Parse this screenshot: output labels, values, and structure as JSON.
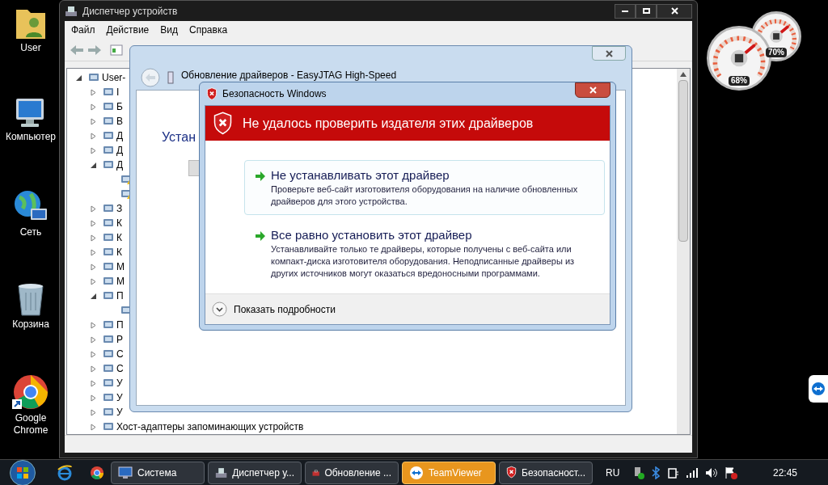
{
  "desktop": {
    "icons": [
      {
        "label": "User",
        "kind": "user"
      },
      {
        "label": "Компьютер",
        "kind": "computer"
      },
      {
        "label": "Сеть",
        "kind": "network"
      },
      {
        "label": "Корзина",
        "kind": "trash"
      },
      {
        "label": "Google Chrome",
        "kind": "chrome"
      }
    ]
  },
  "gadgets": [
    {
      "reading": "68%"
    },
    {
      "reading": "70%"
    }
  ],
  "device_manager": {
    "title": "Диспетчер устройств",
    "menu": [
      "Файл",
      "Действие",
      "Вид",
      "Справка"
    ],
    "tree": {
      "label": "User-",
      "expanded": true,
      "children": [
        {
          "label": "I",
          "expanded": false
        },
        {
          "label": "Б",
          "expanded": false
        },
        {
          "label": "В",
          "expanded": false
        },
        {
          "label": "Д",
          "expanded": false
        },
        {
          "label": "Д",
          "expanded": false
        },
        {
          "label": "Д",
          "expanded": true,
          "children": [
            {
              "warning": true
            },
            {
              "warning": true
            }
          ]
        },
        {
          "label": "З",
          "expanded": false
        },
        {
          "label": "К",
          "expanded": false
        },
        {
          "label": "К",
          "expanded": false
        },
        {
          "label": "К",
          "expanded": false
        },
        {
          "label": "М",
          "expanded": false
        },
        {
          "label": "М",
          "expanded": false
        },
        {
          "label": "П",
          "expanded": true,
          "children": [
            {
              "warning": false
            }
          ]
        },
        {
          "label": "П",
          "expanded": false
        },
        {
          "label": "Р",
          "expanded": false
        },
        {
          "label": "С",
          "expanded": false
        },
        {
          "label": "С",
          "expanded": false
        },
        {
          "label": "У",
          "expanded": false
        },
        {
          "label": "У",
          "expanded": false
        },
        {
          "label": "У",
          "expanded": false
        },
        {
          "label": "Хост-адаптеры запоминающих устройств",
          "expanded": false
        }
      ]
    }
  },
  "update_wizard": {
    "title": "Обновление драйверов - EasyJTAG High-Speed",
    "heading": "Устан"
  },
  "security_dialog": {
    "title": "Безопасность Windows",
    "heading": "Не удалось проверить издателя этих драйверов",
    "options": [
      {
        "title": "Не устанавливать этот драйвер",
        "description": "Проверьте веб-сайт изготовителя оборудования на наличие обновленных драйверов для этого устройства.",
        "selected": true
      },
      {
        "title": "Все равно установить этот драйвер",
        "description": "Устанавливайте только те драйверы, которые получены с веб-сайта или компакт-диска изготовителя оборудования. Неподписанные драйверы из других источников могут оказаться вредоносными программами.",
        "selected": false
      }
    ],
    "details_toggle": "Показать подробности"
  },
  "taskbar": {
    "buttons": [
      {
        "label": "Система",
        "kind": "system",
        "selected": false
      },
      {
        "label": "Диспетчер у...",
        "kind": "devices",
        "selected": false
      },
      {
        "label": "Обновление ...",
        "kind": "wizard",
        "selected": false
      },
      {
        "label": "TeamViewer",
        "kind": "teamviewer",
        "selected": true
      },
      {
        "label": "Безопасност...",
        "kind": "security",
        "selected": false
      }
    ],
    "language": "RU",
    "clock": "22:45"
  }
}
